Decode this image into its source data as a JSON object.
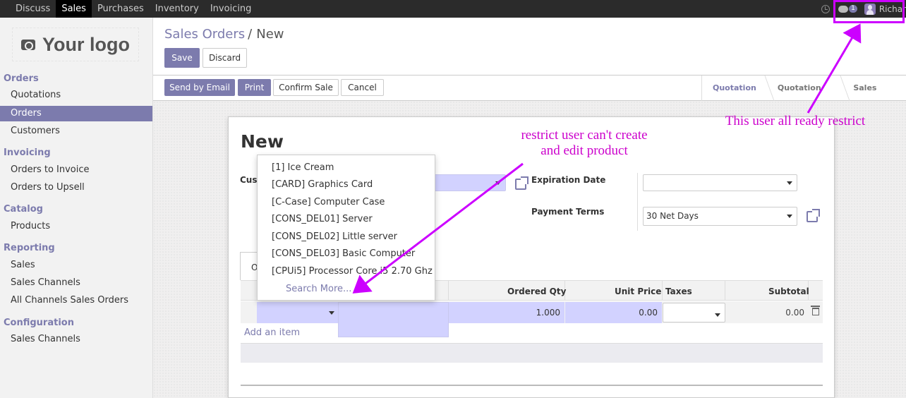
{
  "nav": {
    "apps": [
      "Discuss",
      "Sales",
      "Purchases",
      "Inventory",
      "Invoicing"
    ],
    "active": "Sales",
    "notifications": "1",
    "user": "Richar"
  },
  "sidebar": {
    "logo": "Your logo",
    "orders_title": "Orders",
    "quotations": "Quotations",
    "orders": "Orders",
    "customers": "Customers",
    "invoicing_title": "Invoicing",
    "orders_to_invoice": "Orders to Invoice",
    "orders_to_upsell": "Orders to Upsell",
    "catalog_title": "Catalog",
    "products": "Products",
    "reporting_title": "Reporting",
    "sales": "Sales",
    "sales_channels": "Sales Channels",
    "all_channels": "All Channels Sales Orders",
    "configuration_title": "Configuration",
    "config_sales_channels": "Sales Channels"
  },
  "breadcrumb": {
    "parent": "Sales Orders",
    "separator": "/",
    "current": "New"
  },
  "buttons": {
    "save": "Save",
    "discard": "Discard",
    "send_email": "Send by Email",
    "print": "Print",
    "confirm": "Confirm Sale",
    "cancel": "Cancel"
  },
  "stages": [
    "Quotation",
    "Quotation Sent",
    "Sales Order"
  ],
  "form": {
    "title": "New",
    "customer_label": "Cus",
    "expiration_label": "Expiration Date",
    "payment_terms_label": "Payment Terms",
    "payment_terms_value": "30 Net Days",
    "tab_label": "O"
  },
  "table": {
    "headers": {
      "ordered_qty": "Ordered Qty",
      "unit_price": "Unit Price",
      "taxes": "Taxes",
      "subtotal": "Subtotal"
    },
    "row": {
      "qty": "1.000",
      "price": "0.00",
      "subtotal": "0.00"
    },
    "add_item": "Add an item"
  },
  "dropdown": {
    "items": [
      "[1] Ice Cream",
      "[CARD] Graphics Card",
      "[C-Case] Computer Case",
      "[CONS_DEL01] Server",
      "[CONS_DEL02] Little server",
      "[CONS_DEL03] Basic Computer",
      "[CPUi5] Processor Core i5 2.70 Ghz"
    ],
    "search_more": "Search More..."
  },
  "annotations": {
    "note1_line1": "restrict user can't create",
    "note1_line2": "and edit product",
    "note2": "This user all ready restrict",
    "color": "#cc00cc"
  },
  "colors": {
    "accent": "#7c7bad",
    "topbar": "#2b2b2b",
    "required_field": "#d2d2ff"
  }
}
